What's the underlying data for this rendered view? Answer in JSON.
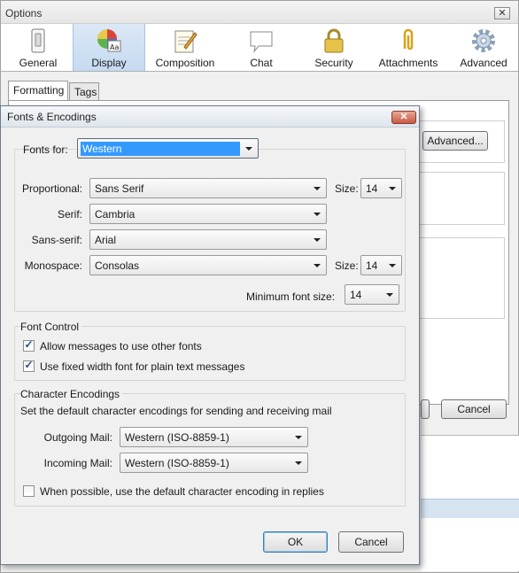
{
  "options_window": {
    "title": "Options",
    "close_glyph": "✕",
    "panes": [
      {
        "label": "General",
        "icon": "light-switch-icon"
      },
      {
        "label": "Display",
        "icon": "color-wheel-icon"
      },
      {
        "label": "Composition",
        "icon": "notepad-pencil-icon"
      },
      {
        "label": "Chat",
        "icon": "speech-bubble-icon"
      },
      {
        "label": "Security",
        "icon": "padlock-icon"
      },
      {
        "label": "Attachments",
        "icon": "paperclip-icon"
      },
      {
        "label": "Advanced",
        "icon": "gear-icon"
      }
    ],
    "selected_pane": "Display",
    "tabs": [
      {
        "label": "Formatting"
      },
      {
        "label": "Tags"
      }
    ],
    "selected_tab": "Formatting",
    "advanced_button": "Advanced...",
    "cancel_button": "Cancel"
  },
  "fonts_dialog": {
    "title": "Fonts & Encodings",
    "close_glyph": "✕",
    "fonts_for": {
      "label": "Fonts for:",
      "value": "Western"
    },
    "proportional": {
      "label": "Proportional:",
      "value": "Sans Serif",
      "size_label": "Size:",
      "size": "14"
    },
    "serif": {
      "label": "Serif:",
      "value": "Cambria"
    },
    "sans_serif": {
      "label": "Sans-serif:",
      "value": "Arial"
    },
    "monospace": {
      "label": "Monospace:",
      "value": "Consolas",
      "size_label": "Size:",
      "size": "14"
    },
    "min_font_size": {
      "label": "Minimum font size:",
      "value": "14"
    },
    "font_control": {
      "heading": "Font Control",
      "allow_other_fonts": {
        "label": "Allow messages to use other fonts",
        "checked": true
      },
      "fixed_width_plain": {
        "label": "Use fixed width font for plain text messages",
        "checked": true
      }
    },
    "encodings": {
      "heading": "Character Encodings",
      "description": "Set the default character encodings for sending and receiving mail",
      "outgoing": {
        "label": "Outgoing Mail:",
        "value": "Western (ISO-8859-1)"
      },
      "incoming": {
        "label": "Incoming Mail:",
        "value": "Western (ISO-8859-1)"
      },
      "default_in_replies": {
        "label": "When possible, use the default character encoding in replies",
        "checked": false
      }
    },
    "ok_button": "OK",
    "cancel_button": "Cancel",
    "check_glyph": "✓"
  },
  "colors": {
    "selection": "#3399ff",
    "selected_pane_bg": "#c6daf1",
    "dialog_close": "#c75a45"
  }
}
